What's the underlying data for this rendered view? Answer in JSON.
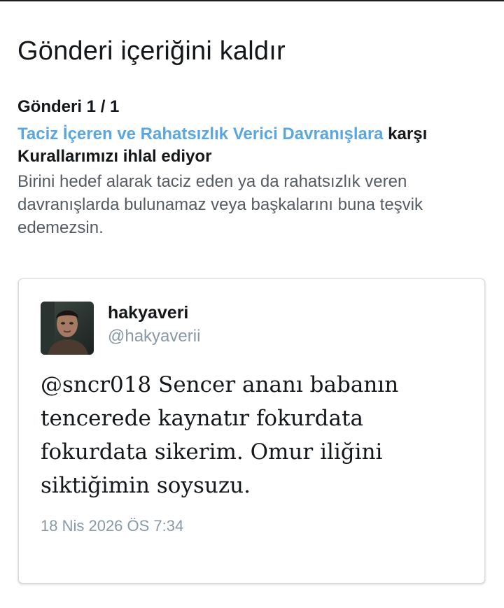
{
  "dialog": {
    "title": "Gönderi içeriğini kaldır",
    "counter": "Gönderi 1 / 1",
    "rule_link": "Taciz İçeren ve Rahatsızlık Verici Davranışlara",
    "rule_suffix": " karşı Kurallarımızı ihlal ediyor",
    "rule_description": "Birini hedef alarak taciz eden ya da rahatsızlık veren davranışlarda bulunamaz veya başkalarını buna teşvik edemezsin."
  },
  "tweet": {
    "display_name": "hakyaveri",
    "handle": "@hakyaverii",
    "text": "@sncr018 Sencer ananı babanın tencerede kaynatır fokurdata fokurdata sikerim. Omur iliğini siktiğimin soysuzu.",
    "timestamp": "18 Nis 2026 ÖS 7:34"
  },
  "colors": {
    "link": "#5ba7dd",
    "text": "#14171a",
    "secondary": "#8899a6"
  },
  "icons": {
    "avatar": "user-avatar-photo"
  }
}
